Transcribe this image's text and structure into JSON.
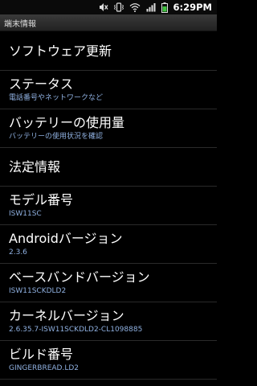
{
  "status_bar": {
    "time": "6:29PM",
    "icons": [
      "mute-icon",
      "vibrate-icon",
      "wifi-icon",
      "signal-icon",
      "battery-icon"
    ],
    "battery_color": "#40c040"
  },
  "title": "端末情報",
  "items": [
    {
      "title": "ソフトウェア更新"
    },
    {
      "title": "ステータス",
      "subtitle": "電話番号やネットワークなど"
    },
    {
      "title": "バッテリーの使用量",
      "subtitle": "バッテリーの使用状況を確認"
    },
    {
      "title": "法定情報"
    },
    {
      "title": "モデル番号",
      "subtitle": "ISW11SC"
    },
    {
      "title": "Androidバージョン",
      "subtitle": "2.3.6"
    },
    {
      "title": "ベースバンドバージョン",
      "subtitle": "ISW11SCKDLD2"
    },
    {
      "title": "カーネルバージョン",
      "subtitle": "2.6.35.7-ISW11SCKDLD2-CL1098885"
    },
    {
      "title": "ビルド番号",
      "subtitle": "GINGERBREAD.LD2"
    }
  ],
  "colors": {
    "subtitle": "#8fb0e0",
    "background": "#000000"
  }
}
